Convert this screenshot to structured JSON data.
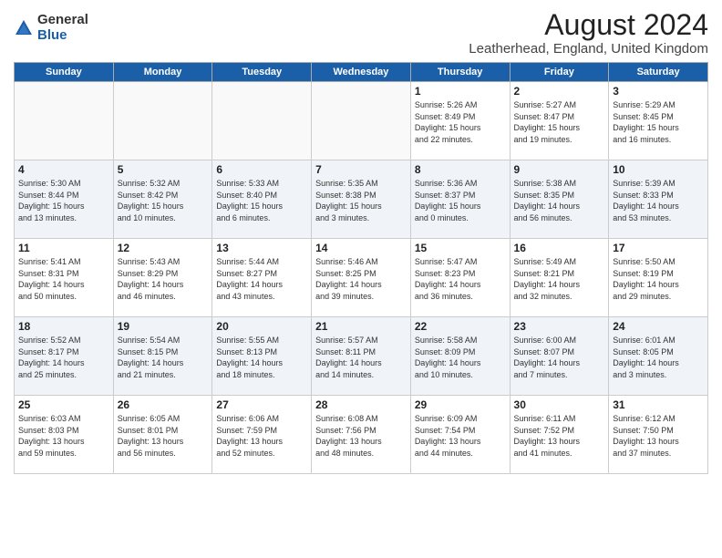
{
  "logo": {
    "general": "General",
    "blue": "Blue"
  },
  "title": "August 2024",
  "location": "Leatherhead, England, United Kingdom",
  "weekdays": [
    "Sunday",
    "Monday",
    "Tuesday",
    "Wednesday",
    "Thursday",
    "Friday",
    "Saturday"
  ],
  "weeks": [
    [
      {
        "day": "",
        "content": ""
      },
      {
        "day": "",
        "content": ""
      },
      {
        "day": "",
        "content": ""
      },
      {
        "day": "",
        "content": ""
      },
      {
        "day": "1",
        "content": "Sunrise: 5:26 AM\nSunset: 8:49 PM\nDaylight: 15 hours\nand 22 minutes."
      },
      {
        "day": "2",
        "content": "Sunrise: 5:27 AM\nSunset: 8:47 PM\nDaylight: 15 hours\nand 19 minutes."
      },
      {
        "day": "3",
        "content": "Sunrise: 5:29 AM\nSunset: 8:45 PM\nDaylight: 15 hours\nand 16 minutes."
      }
    ],
    [
      {
        "day": "4",
        "content": "Sunrise: 5:30 AM\nSunset: 8:44 PM\nDaylight: 15 hours\nand 13 minutes."
      },
      {
        "day": "5",
        "content": "Sunrise: 5:32 AM\nSunset: 8:42 PM\nDaylight: 15 hours\nand 10 minutes."
      },
      {
        "day": "6",
        "content": "Sunrise: 5:33 AM\nSunset: 8:40 PM\nDaylight: 15 hours\nand 6 minutes."
      },
      {
        "day": "7",
        "content": "Sunrise: 5:35 AM\nSunset: 8:38 PM\nDaylight: 15 hours\nand 3 minutes."
      },
      {
        "day": "8",
        "content": "Sunrise: 5:36 AM\nSunset: 8:37 PM\nDaylight: 15 hours\nand 0 minutes."
      },
      {
        "day": "9",
        "content": "Sunrise: 5:38 AM\nSunset: 8:35 PM\nDaylight: 14 hours\nand 56 minutes."
      },
      {
        "day": "10",
        "content": "Sunrise: 5:39 AM\nSunset: 8:33 PM\nDaylight: 14 hours\nand 53 minutes."
      }
    ],
    [
      {
        "day": "11",
        "content": "Sunrise: 5:41 AM\nSunset: 8:31 PM\nDaylight: 14 hours\nand 50 minutes."
      },
      {
        "day": "12",
        "content": "Sunrise: 5:43 AM\nSunset: 8:29 PM\nDaylight: 14 hours\nand 46 minutes."
      },
      {
        "day": "13",
        "content": "Sunrise: 5:44 AM\nSunset: 8:27 PM\nDaylight: 14 hours\nand 43 minutes."
      },
      {
        "day": "14",
        "content": "Sunrise: 5:46 AM\nSunset: 8:25 PM\nDaylight: 14 hours\nand 39 minutes."
      },
      {
        "day": "15",
        "content": "Sunrise: 5:47 AM\nSunset: 8:23 PM\nDaylight: 14 hours\nand 36 minutes."
      },
      {
        "day": "16",
        "content": "Sunrise: 5:49 AM\nSunset: 8:21 PM\nDaylight: 14 hours\nand 32 minutes."
      },
      {
        "day": "17",
        "content": "Sunrise: 5:50 AM\nSunset: 8:19 PM\nDaylight: 14 hours\nand 29 minutes."
      }
    ],
    [
      {
        "day": "18",
        "content": "Sunrise: 5:52 AM\nSunset: 8:17 PM\nDaylight: 14 hours\nand 25 minutes."
      },
      {
        "day": "19",
        "content": "Sunrise: 5:54 AM\nSunset: 8:15 PM\nDaylight: 14 hours\nand 21 minutes."
      },
      {
        "day": "20",
        "content": "Sunrise: 5:55 AM\nSunset: 8:13 PM\nDaylight: 14 hours\nand 18 minutes."
      },
      {
        "day": "21",
        "content": "Sunrise: 5:57 AM\nSunset: 8:11 PM\nDaylight: 14 hours\nand 14 minutes."
      },
      {
        "day": "22",
        "content": "Sunrise: 5:58 AM\nSunset: 8:09 PM\nDaylight: 14 hours\nand 10 minutes."
      },
      {
        "day": "23",
        "content": "Sunrise: 6:00 AM\nSunset: 8:07 PM\nDaylight: 14 hours\nand 7 minutes."
      },
      {
        "day": "24",
        "content": "Sunrise: 6:01 AM\nSunset: 8:05 PM\nDaylight: 14 hours\nand 3 minutes."
      }
    ],
    [
      {
        "day": "25",
        "content": "Sunrise: 6:03 AM\nSunset: 8:03 PM\nDaylight: 13 hours\nand 59 minutes."
      },
      {
        "day": "26",
        "content": "Sunrise: 6:05 AM\nSunset: 8:01 PM\nDaylight: 13 hours\nand 56 minutes."
      },
      {
        "day": "27",
        "content": "Sunrise: 6:06 AM\nSunset: 7:59 PM\nDaylight: 13 hours\nand 52 minutes."
      },
      {
        "day": "28",
        "content": "Sunrise: 6:08 AM\nSunset: 7:56 PM\nDaylight: 13 hours\nand 48 minutes."
      },
      {
        "day": "29",
        "content": "Sunrise: 6:09 AM\nSunset: 7:54 PM\nDaylight: 13 hours\nand 44 minutes."
      },
      {
        "day": "30",
        "content": "Sunrise: 6:11 AM\nSunset: 7:52 PM\nDaylight: 13 hours\nand 41 minutes."
      },
      {
        "day": "31",
        "content": "Sunrise: 6:12 AM\nSunset: 7:50 PM\nDaylight: 13 hours\nand 37 minutes."
      }
    ]
  ]
}
